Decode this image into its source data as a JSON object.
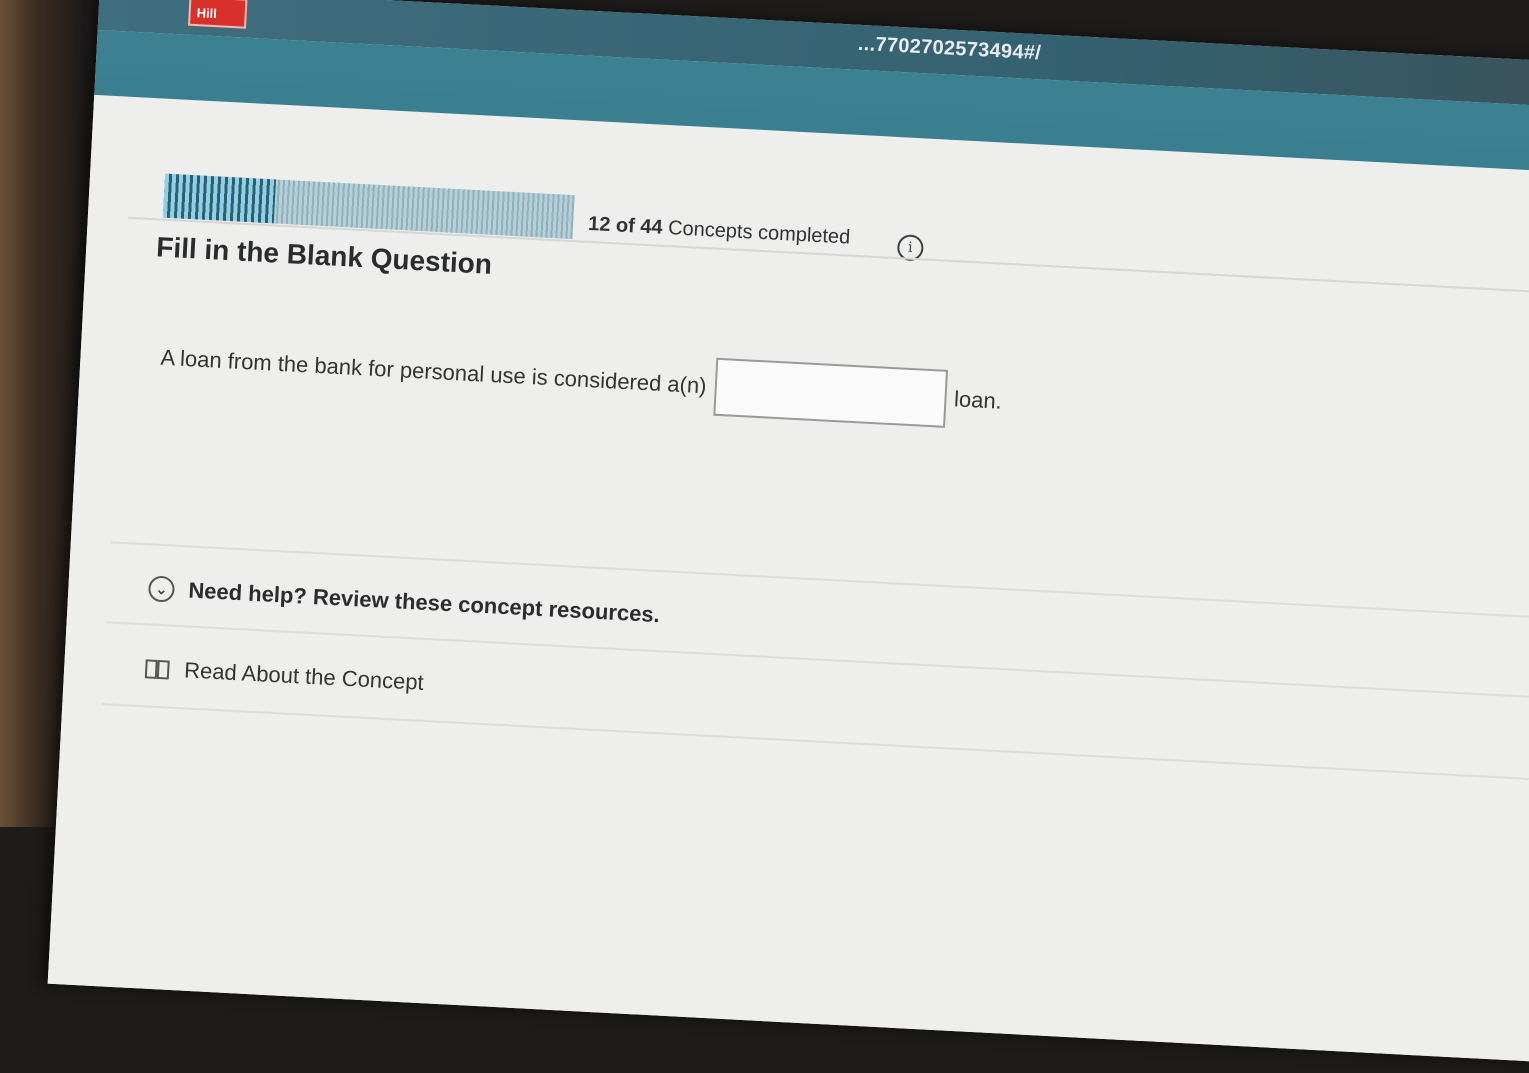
{
  "browser": {
    "url": "...7702702573494#/",
    "logo_text": "Hill"
  },
  "progress": {
    "completed": "12",
    "of_label": "of",
    "total": "44",
    "label": "Concepts completed",
    "fraction": 0.27
  },
  "question": {
    "title": "Fill in the Blank Question",
    "text_before": "A loan from the bank for personal use is considered a(n)",
    "blank_value": "",
    "text_after": "loan."
  },
  "help": {
    "header": "Need help? Review these concept resources.",
    "read_link": "Read About the Concept"
  },
  "colors": {
    "accent": "#3a7c8e",
    "brand_red": "#d8302b"
  }
}
